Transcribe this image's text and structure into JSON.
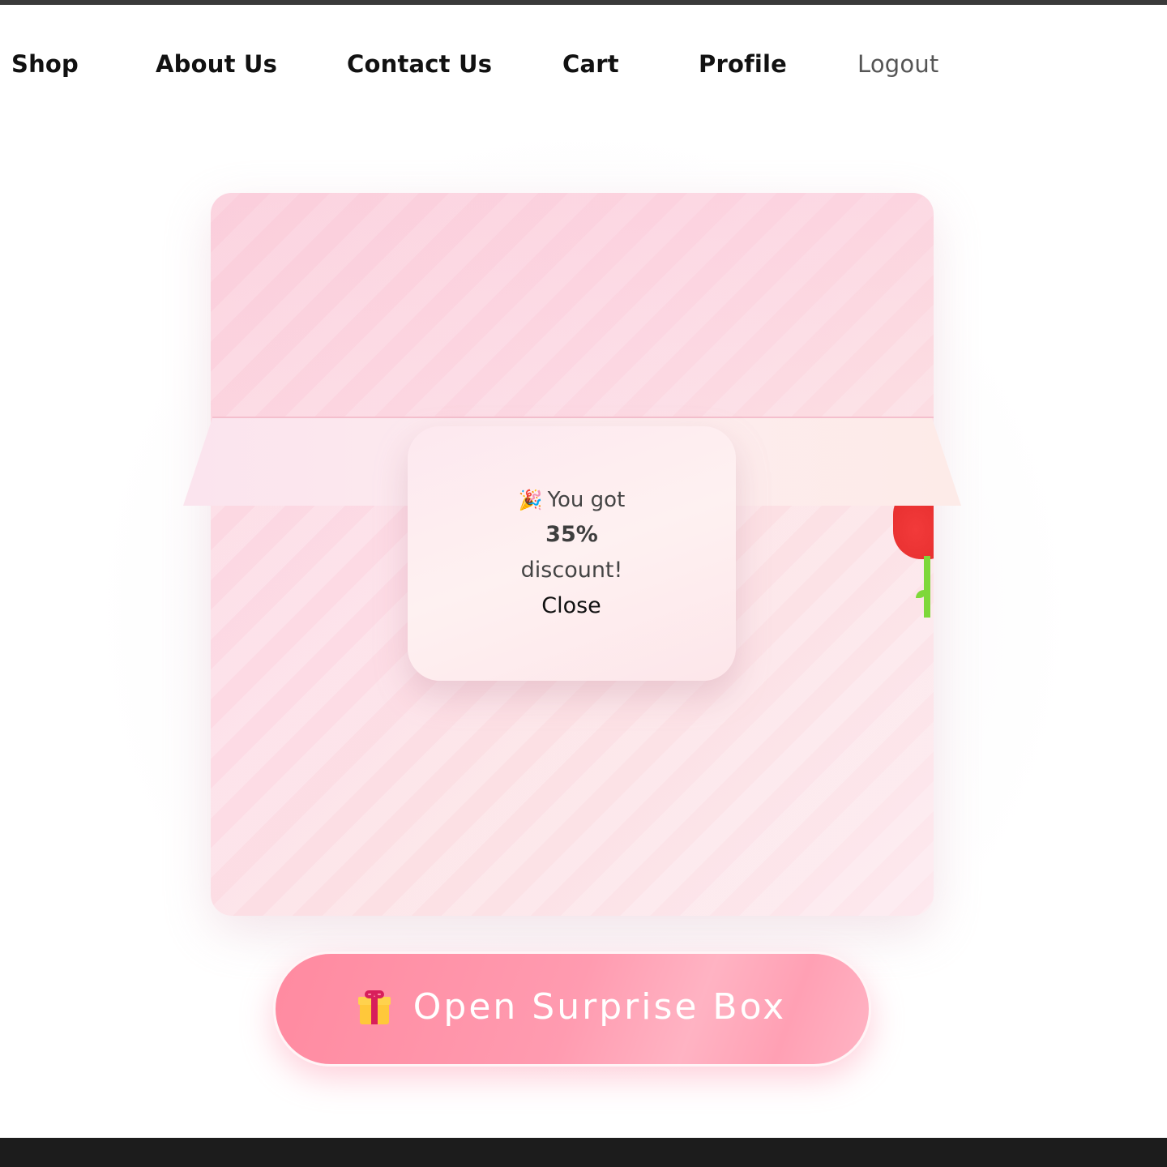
{
  "nav": {
    "items": [
      "Shop",
      "About Us",
      "Contact Us",
      "Cart",
      "Profile"
    ],
    "logout": "Logout"
  },
  "popup": {
    "icon": "party-popper-icon",
    "line1": "You got",
    "percent": "35%",
    "line3": "discount!",
    "close_label": "Close"
  },
  "cta": {
    "icon": "gift-icon",
    "label": "Open Surprise Box"
  },
  "colors": {
    "accent_pink": "#ff8aa0",
    "box_pink": "#fbd3de",
    "rose_red": "#e83030",
    "stem_green": "#7ed83a"
  }
}
